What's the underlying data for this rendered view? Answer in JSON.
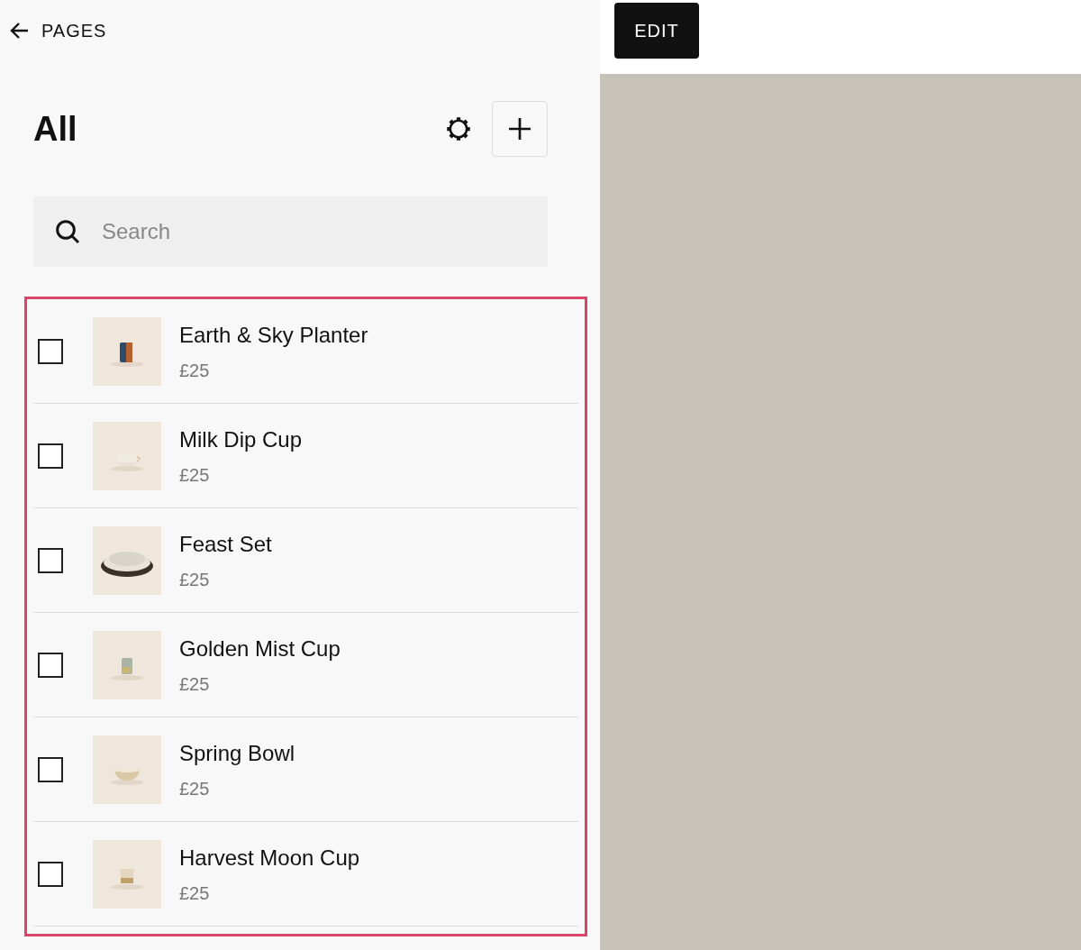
{
  "header": {
    "back_label": "PAGES"
  },
  "title": "All",
  "search": {
    "placeholder": "Search"
  },
  "product_list": {
    "highlighted": true,
    "items": [
      {
        "name": "Earth & Sky Planter",
        "price": "£25",
        "checked": false
      },
      {
        "name": "Milk Dip Cup",
        "price": "£25",
        "checked": false
      },
      {
        "name": "Feast Set",
        "price": "£25",
        "checked": false
      },
      {
        "name": "Golden Mist Cup",
        "price": "£25",
        "checked": false
      },
      {
        "name": "Spring Bowl",
        "price": "£25",
        "checked": false
      },
      {
        "name": "Harvest Moon Cup",
        "price": "£25",
        "checked": false
      }
    ]
  },
  "edit_button": "EDIT"
}
